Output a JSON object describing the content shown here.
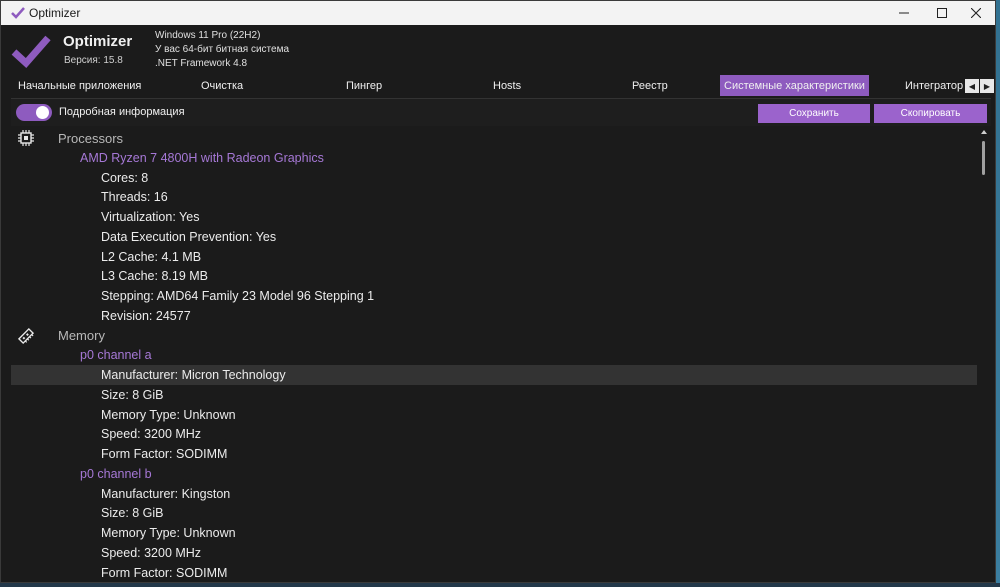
{
  "window": {
    "title": "Optimizer"
  },
  "header": {
    "app_name": "Optimizer",
    "version": "Версия: 15.8",
    "os": "Windows 11 Pro (22H2)",
    "arch": "У вас 64-бит битная система",
    "framework": ".NET Framework 4.8"
  },
  "tabs": [
    {
      "label": "Начальные приложения"
    },
    {
      "label": "Очистка"
    },
    {
      "label": "Пингер"
    },
    {
      "label": "Hosts"
    },
    {
      "label": "Реестр"
    },
    {
      "label": "Системные характеристики",
      "active": true
    },
    {
      "label": "Интегратор"
    }
  ],
  "toolbar": {
    "toggle_label": "Подробная информация",
    "toggle_on": true,
    "save_label": "Сохранить",
    "copy_label": "Скопировать"
  },
  "colors": {
    "accent": "#8e5bbf",
    "group_text": "#a678d6",
    "background": "#1b1b1b"
  },
  "content": {
    "rows": [
      {
        "level": 0,
        "text": "Processors",
        "icon": "cpu-icon"
      },
      {
        "level": 1,
        "text": "AMD Ryzen 7 4800H with Radeon Graphics"
      },
      {
        "level": 2,
        "text": "Cores: 8"
      },
      {
        "level": 2,
        "text": "Threads: 16"
      },
      {
        "level": 2,
        "text": "Virtualization: Yes"
      },
      {
        "level": 2,
        "text": "Data Execution Prevention: Yes"
      },
      {
        "level": 2,
        "text": "L2 Cache: 4.1 MB"
      },
      {
        "level": 2,
        "text": "L3 Cache: 8.19 MB"
      },
      {
        "level": 2,
        "text": "Stepping: AMD64 Family 23 Model 96 Stepping 1"
      },
      {
        "level": 2,
        "text": "Revision: 24577"
      },
      {
        "level": 0,
        "text": "Memory",
        "icon": "memory-icon"
      },
      {
        "level": 1,
        "text": "p0 channel a"
      },
      {
        "level": 2,
        "text": "Manufacturer: Micron Technology",
        "selected": true
      },
      {
        "level": 2,
        "text": "Size: 8 GiB"
      },
      {
        "level": 2,
        "text": "Memory Type: Unknown"
      },
      {
        "level": 2,
        "text": "Speed: 3200 MHz"
      },
      {
        "level": 2,
        "text": "Form Factor: SODIMM"
      },
      {
        "level": 1,
        "text": "p0 channel b"
      },
      {
        "level": 2,
        "text": "Manufacturer: Kingston"
      },
      {
        "level": 2,
        "text": "Size: 8 GiB"
      },
      {
        "level": 2,
        "text": "Memory Type: Unknown"
      },
      {
        "level": 2,
        "text": "Speed: 3200 MHz"
      },
      {
        "level": 2,
        "text": "Form Factor: SODIMM"
      }
    ]
  }
}
